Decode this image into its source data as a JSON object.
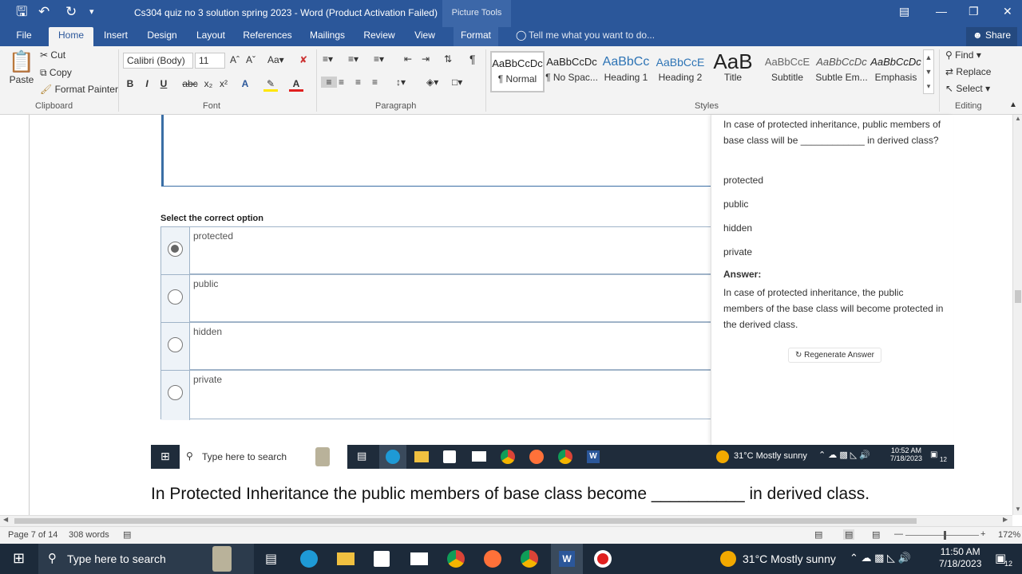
{
  "window": {
    "title": "Cs304 quiz no 3 solution spring 2023 - Word (Product Activation Failed)",
    "context_tab": "Picture Tools"
  },
  "tabs": [
    "File",
    "Home",
    "Insert",
    "Design",
    "Layout",
    "References",
    "Mailings",
    "Review",
    "View",
    "Format"
  ],
  "tell_me": "Tell me what you want to do...",
  "share": "Share",
  "clipboard": {
    "paste": "Paste",
    "cut": "Cut",
    "copy": "Copy",
    "format_painter": "Format Painter",
    "label": "Clipboard"
  },
  "font": {
    "name": "Calibri (Body)",
    "size": "11",
    "label": "Font"
  },
  "paragraph": {
    "label": "Paragraph"
  },
  "styles": {
    "label": "Styles",
    "items": [
      {
        "preview": "AaBbCcDc",
        "name": "¶ Normal"
      },
      {
        "preview": "AaBbCcDc",
        "name": "¶ No Spac..."
      },
      {
        "preview": "AaBbCc",
        "name": "Heading 1"
      },
      {
        "preview": "AaBbCcE",
        "name": "Heading 2"
      },
      {
        "preview": "AaB",
        "name": "Title"
      },
      {
        "preview": "AaBbCcE",
        "name": "Subtitle"
      },
      {
        "preview": "AaBbCcDc",
        "name": "Subtle Em..."
      },
      {
        "preview": "AaBbCcDc",
        "name": "Emphasis"
      }
    ]
  },
  "editing": {
    "find": "Find",
    "replace": "Replace",
    "select": "Select",
    "label": "Editing"
  },
  "quiz": {
    "prompt": "Select the correct option",
    "options": [
      "protected",
      "public",
      "hidden",
      "private"
    ]
  },
  "panel": {
    "question": "In case of protected inheritance, public members of base class will be ____________ in derived class?",
    "options": [
      "protected",
      "public",
      "hidden",
      "private"
    ],
    "answer_label": "Answer:",
    "answer_text": "In case of protected inheritance, the public members of the base class will become protected in the derived class.",
    "regenerate": "Regenerate Answer"
  },
  "inner_taskbar": {
    "search": "Type here to search",
    "weather": "31°C  Mostly sunny",
    "time": "10:52 AM",
    "date": "7/18/2023",
    "notif": "12"
  },
  "doc_text": "In Protected Inheritance the public members of base class become __________ in derived class.",
  "status": {
    "page": "Page 7 of 14",
    "words": "308 words",
    "zoom": "172%"
  },
  "taskbar": {
    "search": "Type here to search",
    "weather": "31°C  Mostly sunny",
    "time": "11:50 AM",
    "date": "7/18/2023",
    "notif": "12"
  }
}
